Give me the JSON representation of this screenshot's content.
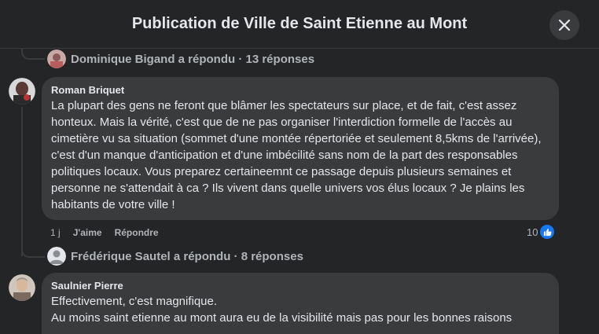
{
  "dialog": {
    "title": "Publication de Ville de Saint Etienne au Mont",
    "close_icon": "close-icon"
  },
  "replies_top": {
    "text": "Dominique Bigand a répondu · 13 réponses"
  },
  "comment1": {
    "author": "Roman Briquet",
    "text": "La plupart des gens ne feront que blâmer les spectateurs sur place, et de fait, c'est assez honteux. Mais la vérité, c'est que de ne pas organiser l'interdiction formelle de l'accès au cimetière vu sa situation (sommet d'une montée répertoriée et seulement 8,5kms de l'arrivée), c'est d'un manque d'anticipation et d'une imbécilité sans nom de la part des responsables politiques locaux. Vous preparez certaineemnt ce passage depuis plusieurs semaines et personne ne s'attendait à ca ? Ils vivent dans quelle univers vos élus locaux ? Je plains les habitants de votre ville !",
    "time": "1 j",
    "like_label": "J'aime",
    "reply_label": "Répondre",
    "like_count": "10"
  },
  "replies_mid": {
    "text": "Frédérique Sautel a répondu · 8 réponses"
  },
  "comment2": {
    "author": "Saulnier Pierre",
    "line1": "Effectivement, c'est magnifique.",
    "line2": "Au moins saint etienne au mont aura eu de la visibilité mais pas pour les bonnes raisons"
  },
  "colors": {
    "background": "#242526",
    "bubble": "#3a3b3c",
    "text": "#e4e6eb",
    "muted": "#b0b3b8",
    "like_blue": "#1877f2"
  }
}
